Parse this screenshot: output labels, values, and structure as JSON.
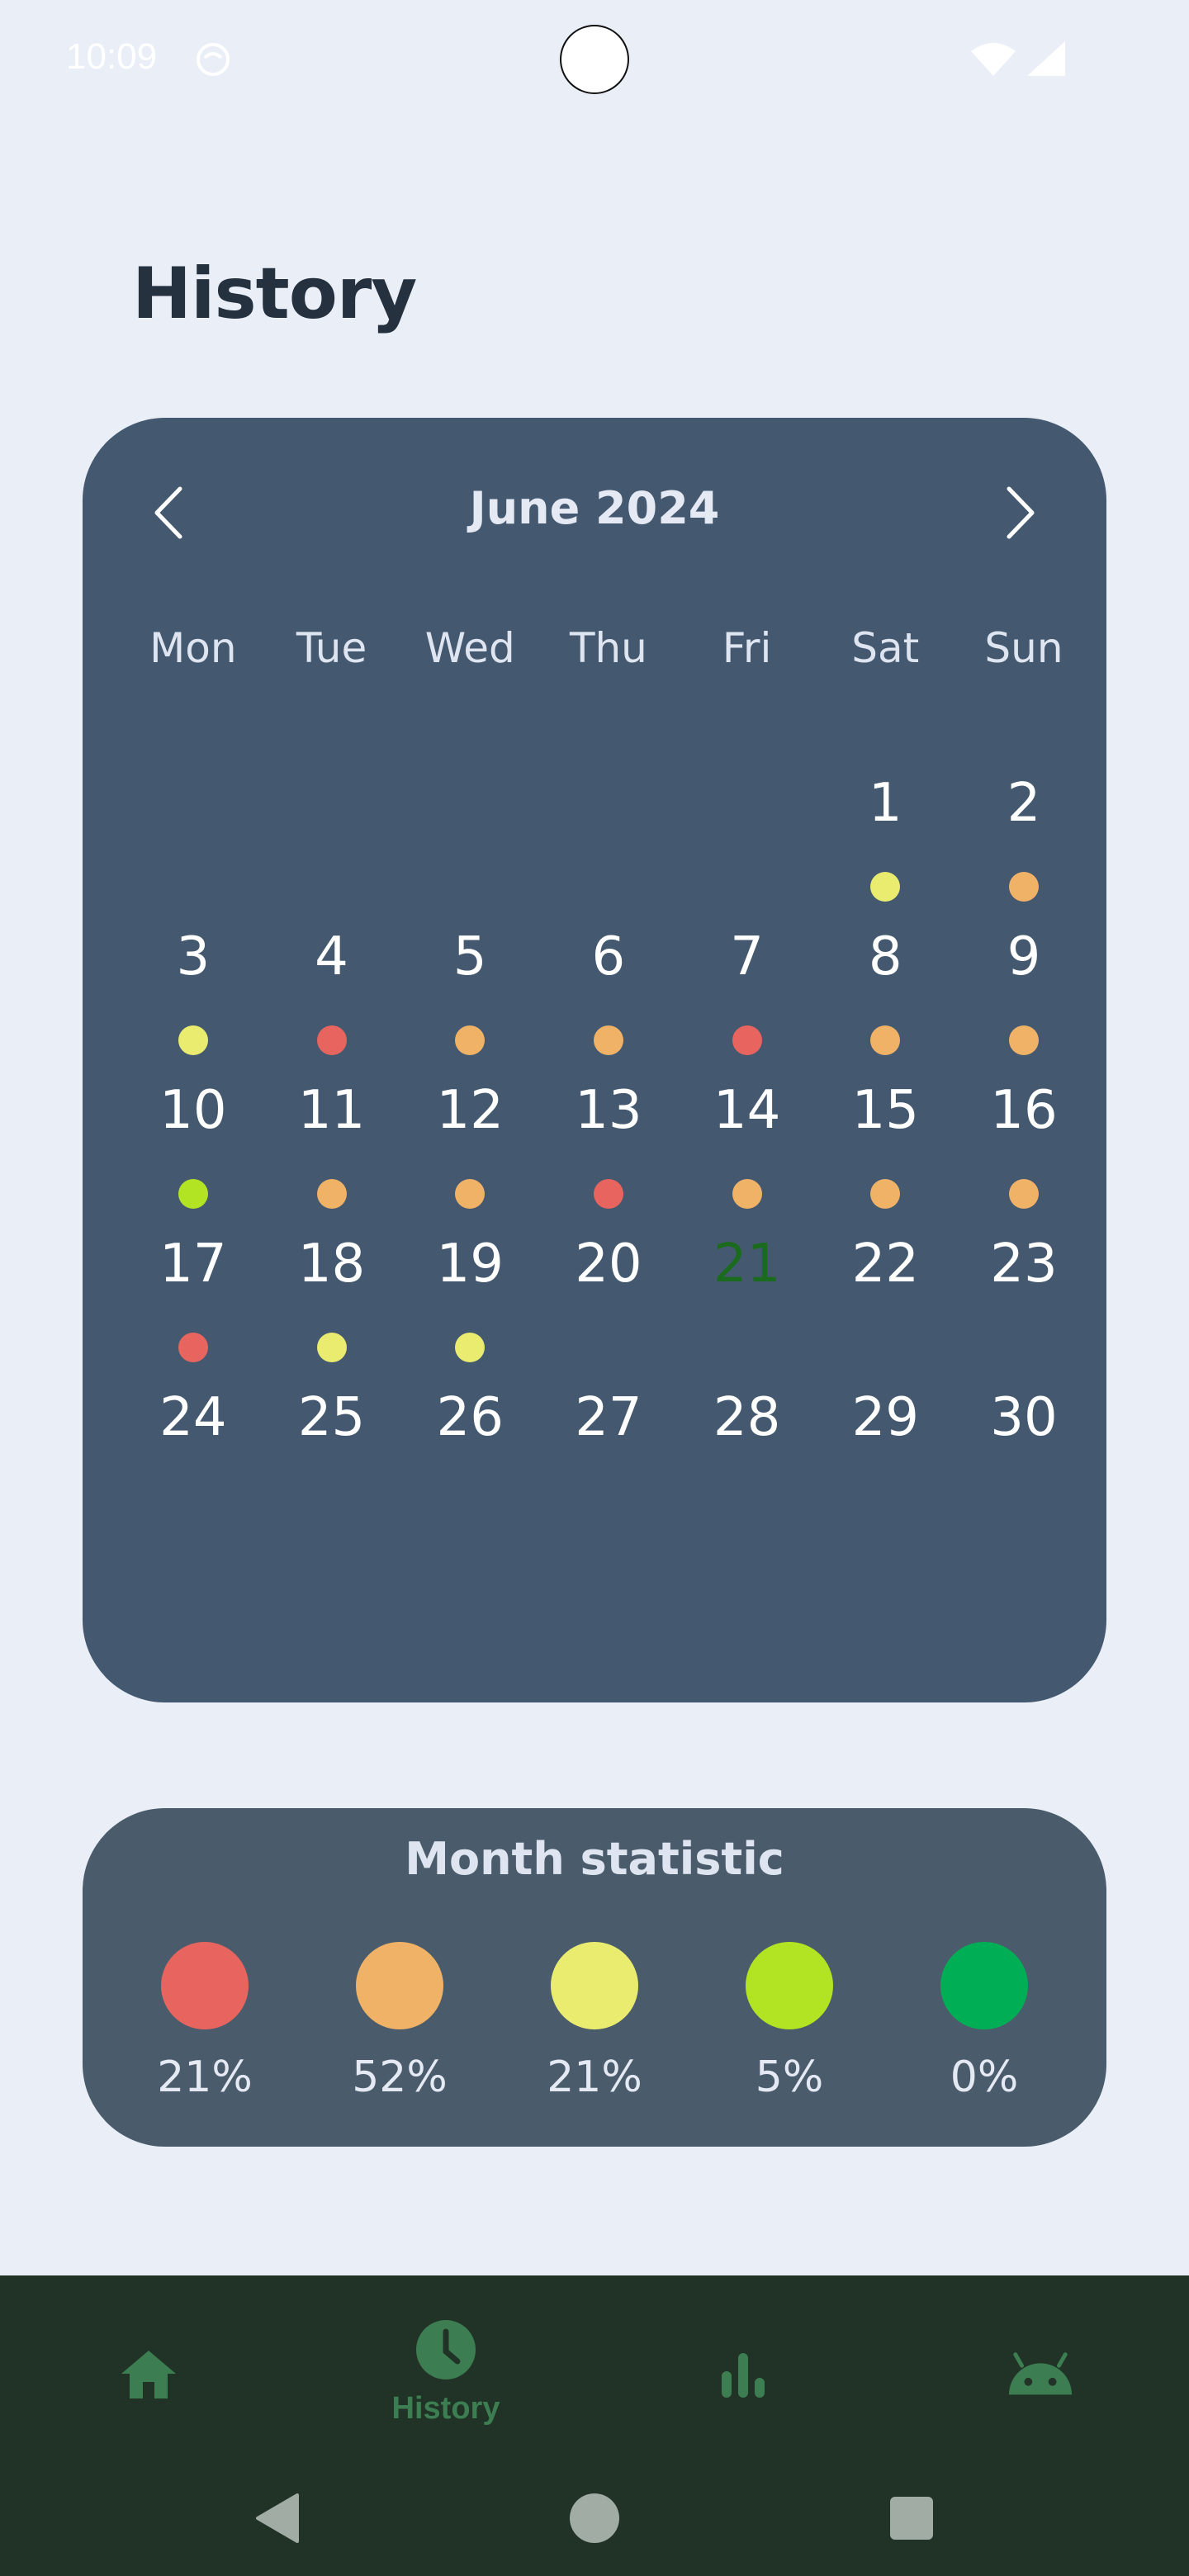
{
  "status_bar": {
    "time": "10:09"
  },
  "page": {
    "title": "History"
  },
  "calendar": {
    "month_label": "June 2024",
    "weekdays": [
      "Mon",
      "Tue",
      "Wed",
      "Thu",
      "Fri",
      "Sat",
      "Sun"
    ],
    "today": 21,
    "weeks": [
      [
        null,
        null,
        null,
        null,
        null,
        {
          "day": 1,
          "mood": "yellow"
        },
        {
          "day": 2,
          "mood": "orange"
        }
      ],
      [
        {
          "day": 3,
          "mood": "yellow"
        },
        {
          "day": 4,
          "mood": "red"
        },
        {
          "day": 5,
          "mood": "orange"
        },
        {
          "day": 6,
          "mood": "orange"
        },
        {
          "day": 7,
          "mood": "red"
        },
        {
          "day": 8,
          "mood": "orange"
        },
        {
          "day": 9,
          "mood": "orange"
        }
      ],
      [
        {
          "day": 10,
          "mood": "lime"
        },
        {
          "day": 11,
          "mood": "orange"
        },
        {
          "day": 12,
          "mood": "orange"
        },
        {
          "day": 13,
          "mood": "red"
        },
        {
          "day": 14,
          "mood": "orange"
        },
        {
          "day": 15,
          "mood": "orange"
        },
        {
          "day": 16,
          "mood": "orange"
        }
      ],
      [
        {
          "day": 17,
          "mood": "red"
        },
        {
          "day": 18,
          "mood": "yellow"
        },
        {
          "day": 19,
          "mood": "yellow"
        },
        {
          "day": 20,
          "mood": null
        },
        {
          "day": 21,
          "mood": null
        },
        {
          "day": 22,
          "mood": null
        },
        {
          "day": 23,
          "mood": null
        }
      ],
      [
        {
          "day": 24,
          "mood": null
        },
        {
          "day": 25,
          "mood": null
        },
        {
          "day": 26,
          "mood": null
        },
        {
          "day": 27,
          "mood": null
        },
        {
          "day": 28,
          "mood": null
        },
        {
          "day": 29,
          "mood": null
        },
        {
          "day": 30,
          "mood": null
        }
      ]
    ]
  },
  "mood_colors": {
    "red": "#e8645f",
    "orange": "#f0b266",
    "yellow": "#e9ec6f",
    "lime": "#b3e423",
    "green": "#00ae55"
  },
  "month_statistic": {
    "title": "Month statistic",
    "items": [
      {
        "mood": "red",
        "value": "21%"
      },
      {
        "mood": "orange",
        "value": "52%"
      },
      {
        "mood": "yellow",
        "value": "21%"
      },
      {
        "mood": "lime",
        "value": "5%"
      },
      {
        "mood": "green",
        "value": "0%"
      }
    ]
  },
  "bottom_nav": {
    "items": [
      {
        "icon": "home-icon",
        "label": "",
        "active": false
      },
      {
        "icon": "clock-icon",
        "label": "History",
        "active": true
      },
      {
        "icon": "bar-chart-icon",
        "label": "",
        "active": false
      },
      {
        "icon": "android-icon",
        "label": "",
        "active": false
      }
    ]
  },
  "system_nav": {
    "buttons": [
      "back-icon",
      "home-circle-icon",
      "recents-icon"
    ]
  },
  "colors": {
    "background": "#e9eef7",
    "calendar_card": "#44596f",
    "stats_card": "#4a5c6b",
    "bottom_nav": "#213326",
    "nav_accent": "#3d7d52",
    "today_text": "#1b6b1f"
  }
}
